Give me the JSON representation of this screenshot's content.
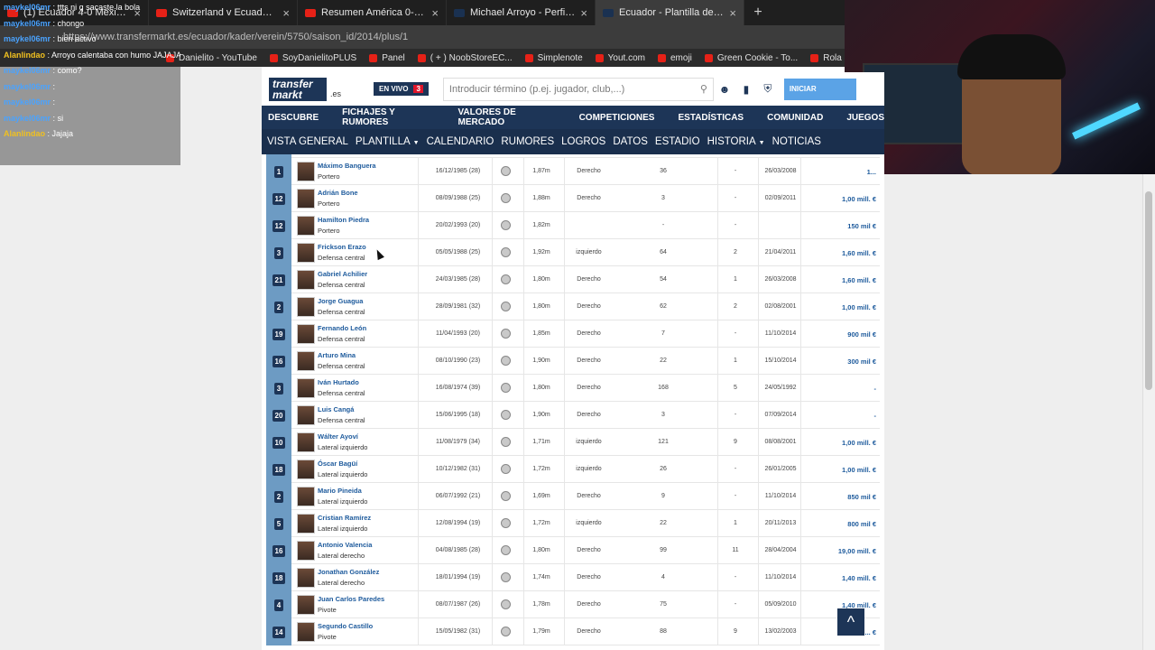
{
  "browser": {
    "tabs": [
      {
        "title": "(1) Ecuador 4-0 Mexico | Highlights",
        "icon": "youtube-icon"
      },
      {
        "title": "Switzerland v Ecuador | 2014 FIFA",
        "icon": "youtube-icon"
      },
      {
        "title": "Resumen América 0-2 Real Madrid",
        "icon": "youtube-icon"
      },
      {
        "title": "Michael Arroyo - Perfil del jugador",
        "icon": "transfermarkt-icon"
      },
      {
        "title": "Ecuador - Plantilla detallada 2014",
        "icon": "transfermarkt-icon",
        "active": true
      }
    ],
    "new_tab": "+",
    "url": "https://www.transfermarkt.es/ecuador/kader/verein/5750/saison_id/2014/plus/1",
    "bookmarks": [
      "Danielito - YouTube",
      "SoyDanielitoPLUS",
      "Panel",
      "( + ) NoobStoreEC...",
      "Simplenote",
      "Yout.com",
      "emoji",
      "Green Cookie - To...",
      "Rola"
    ]
  },
  "chat": [
    {
      "user": "maykel06mr",
      "msg": "ttts ni q sacaste la bola"
    },
    {
      "user": "maykel06mr",
      "msg": "chongo"
    },
    {
      "user": "maykel06mr",
      "msg": "bien activo"
    },
    {
      "user": "Alanlindao",
      "msg": "Arroyo calentaba con humo JAJAJA"
    },
    {
      "user": "maykel06mr",
      "msg": "como?"
    },
    {
      "user": "maykel06mr",
      "msg": ""
    },
    {
      "user": "maykel06mr",
      "msg": ""
    },
    {
      "user": "maykel06mr",
      "msg": "si"
    },
    {
      "user": "Alanlindao",
      "msg": "Jajaja"
    }
  ],
  "header": {
    "logo": "transfer markt",
    "logo_domain": ".es",
    "live_label": "EN VIVO",
    "live_count": "3",
    "search_placeholder": "Introducir término (p.ej. jugador, club,...)",
    "login_label": "INICIAR"
  },
  "main_nav": [
    "DESCUBRE",
    "FICHAJES Y RUMORES",
    "VALORES DE MERCADO",
    "COMPETICIONES",
    "ESTADÍSTICAS",
    "COMUNIDAD",
    "JUEGOS"
  ],
  "sub_nav": [
    {
      "label": "VISTA GENERAL",
      "dropdown": false
    },
    {
      "label": "PLANTILLA",
      "dropdown": true
    },
    {
      "label": "CALENDARIO",
      "dropdown": false
    },
    {
      "label": "RUMORES",
      "dropdown": false
    },
    {
      "label": "LOGROS",
      "dropdown": false
    },
    {
      "label": "DATOS",
      "dropdown": false
    },
    {
      "label": "ESTADIO",
      "dropdown": false
    },
    {
      "label": "HISTORIA",
      "dropdown": true
    },
    {
      "label": "NOTICIAS",
      "dropdown": false
    }
  ],
  "players": [
    {
      "num": "1",
      "name": "Máximo Banguera",
      "pos": "Portero",
      "dob": "16/12/1985 (28)",
      "height": "1,87m",
      "foot": "Derecho",
      "apps": "36",
      "goals": "-",
      "debut": "26/03/2008",
      "value": "1..."
    },
    {
      "num": "12",
      "name": "Adrián Bone",
      "pos": "Portero",
      "dob": "08/09/1988 (25)",
      "height": "1,88m",
      "foot": "Derecho",
      "apps": "3",
      "goals": "-",
      "debut": "02/09/2011",
      "value": "1,00 mill. €"
    },
    {
      "num": "12",
      "name": "Hamilton Piedra",
      "pos": "Portero",
      "dob": "20/02/1993 (20)",
      "height": "1,82m",
      "foot": "",
      "apps": "-",
      "goals": "-",
      "debut": "",
      "value": "150 mil €"
    },
    {
      "num": "3",
      "name": "Frickson Erazo",
      "pos": "Defensa central",
      "dob": "05/05/1988 (25)",
      "height": "1,92m",
      "foot": "izquierdo",
      "apps": "64",
      "goals": "2",
      "debut": "21/04/2011",
      "value": "1,60 mill. €"
    },
    {
      "num": "21",
      "name": "Gabriel Achilier",
      "pos": "Defensa central",
      "dob": "24/03/1985 (28)",
      "height": "1,80m",
      "foot": "Derecho",
      "apps": "54",
      "goals": "1",
      "debut": "26/03/2008",
      "value": "1,60 mill. €"
    },
    {
      "num": "2",
      "name": "Jorge Guagua",
      "pos": "Defensa central",
      "dob": "28/09/1981 (32)",
      "height": "1,80m",
      "foot": "Derecho",
      "apps": "62",
      "goals": "2",
      "debut": "02/08/2001",
      "value": "1,00 mill. €"
    },
    {
      "num": "19",
      "name": "Fernando León",
      "pos": "Defensa central",
      "dob": "11/04/1993 (20)",
      "height": "1,85m",
      "foot": "Derecho",
      "apps": "7",
      "goals": "-",
      "debut": "11/10/2014",
      "value": "900 mil €"
    },
    {
      "num": "16",
      "name": "Arturo Mina",
      "pos": "Defensa central",
      "dob": "08/10/1990 (23)",
      "height": "1,90m",
      "foot": "Derecho",
      "apps": "22",
      "goals": "1",
      "debut": "15/10/2014",
      "value": "300 mil €"
    },
    {
      "num": "3",
      "name": "Iván Hurtado",
      "pos": "Defensa central",
      "dob": "16/08/1974 (39)",
      "height": "1,80m",
      "foot": "Derecho",
      "apps": "168",
      "goals": "5",
      "debut": "24/05/1992",
      "value": "-"
    },
    {
      "num": "20",
      "name": "Luis Cangá",
      "pos": "Defensa central",
      "dob": "15/06/1995 (18)",
      "height": "1,90m",
      "foot": "Derecho",
      "apps": "3",
      "goals": "-",
      "debut": "07/09/2014",
      "value": "-"
    },
    {
      "num": "10",
      "name": "Wálter Ayoví",
      "pos": "Lateral izquierdo",
      "dob": "11/08/1979 (34)",
      "height": "1,71m",
      "foot": "izquierdo",
      "apps": "121",
      "goals": "9",
      "debut": "08/08/2001",
      "value": "1,00 mill. €"
    },
    {
      "num": "18",
      "name": "Óscar Bagüí",
      "pos": "Lateral izquierdo",
      "dob": "10/12/1982 (31)",
      "height": "1,72m",
      "foot": "izquierdo",
      "apps": "26",
      "goals": "-",
      "debut": "26/01/2005",
      "value": "1,00 mill. €"
    },
    {
      "num": "2",
      "name": "Mario Pineida",
      "pos": "Lateral izquierdo",
      "dob": "06/07/1992 (21)",
      "height": "1,69m",
      "foot": "Derecho",
      "apps": "9",
      "goals": "-",
      "debut": "11/10/2014",
      "value": "850 mil €"
    },
    {
      "num": "5",
      "name": "Cristian Ramírez",
      "pos": "Lateral izquierdo",
      "dob": "12/08/1994 (19)",
      "height": "1,72m",
      "foot": "izquierdo",
      "apps": "22",
      "goals": "1",
      "debut": "20/11/2013",
      "value": "800 mil €"
    },
    {
      "num": "16",
      "name": "Antonio Valencia",
      "pos": "Lateral derecho",
      "dob": "04/08/1985 (28)",
      "height": "1,80m",
      "foot": "Derecho",
      "apps": "99",
      "goals": "11",
      "debut": "28/04/2004",
      "value": "19,00 mill. €"
    },
    {
      "num": "18",
      "name": "Jonathan González",
      "pos": "Lateral derecho",
      "dob": "18/01/1994 (19)",
      "height": "1,74m",
      "foot": "Derecho",
      "apps": "4",
      "goals": "-",
      "debut": "11/10/2014",
      "value": "1,40 mill. €"
    },
    {
      "num": "4",
      "name": "Juan Carlos Paredes",
      "pos": "Pivote",
      "dob": "08/07/1987 (26)",
      "height": "1,78m",
      "foot": "Derecho",
      "apps": "75",
      "goals": "-",
      "debut": "05/09/2010",
      "value": "1,40 mill. €"
    },
    {
      "num": "14",
      "name": "Segundo Castillo",
      "pos": "Pivote",
      "dob": "15/05/1982 (31)",
      "height": "1,79m",
      "foot": "Derecho",
      "apps": "88",
      "goals": "9",
      "debut": "13/02/2003",
      "value": "... €"
    }
  ],
  "back_to_top": "^"
}
